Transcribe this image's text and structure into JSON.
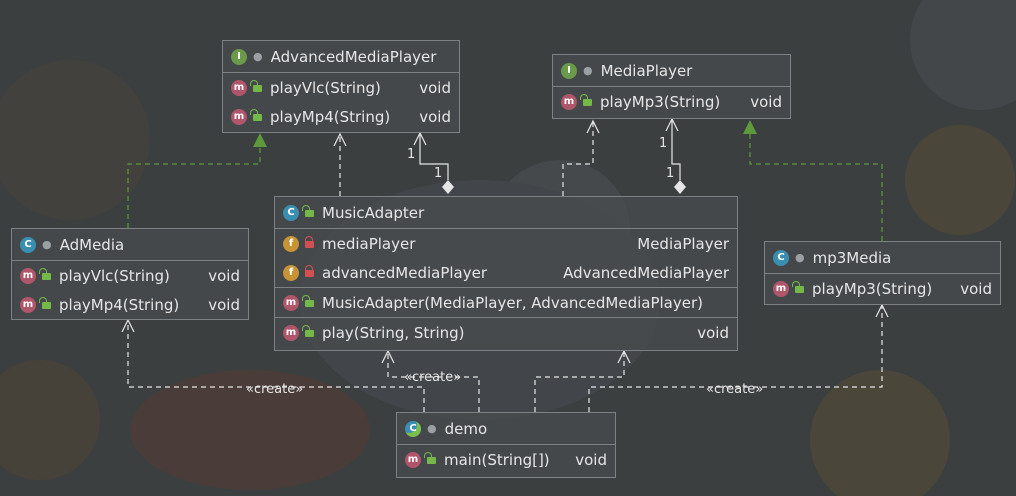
{
  "colors": {
    "background": "#3b3e3f",
    "box": "#484c4f",
    "border": "#7c8185",
    "implements_arrow": "#5d9a3c",
    "association_line": "#e6e6e6"
  },
  "classes": {
    "advanced_media_player": {
      "name": "AdvancedMediaPlayer",
      "kind_icon": "I",
      "methods": [
        {
          "name": "playVlc(String)",
          "type": "void"
        },
        {
          "name": "playMp4(String)",
          "type": "void"
        }
      ]
    },
    "media_player": {
      "name": "MediaPlayer",
      "kind_icon": "I",
      "methods": [
        {
          "name": "playMp3(String)",
          "type": "void"
        }
      ]
    },
    "ad_media": {
      "name": "AdMedia",
      "kind_icon": "C",
      "methods": [
        {
          "name": "playVlc(String)",
          "type": "void"
        },
        {
          "name": "playMp4(String)",
          "type": "void"
        }
      ]
    },
    "music_adapter": {
      "name": "MusicAdapter",
      "kind_icon": "C",
      "fields": [
        {
          "name": "mediaPlayer",
          "type": "MediaPlayer"
        },
        {
          "name": "advancedMediaPlayer",
          "type": "AdvancedMediaPlayer"
        }
      ],
      "constructor": {
        "name": "MusicAdapter(MediaPlayer, AdvancedMediaPlayer)"
      },
      "methods": [
        {
          "name": "play(String, String)",
          "type": "void"
        }
      ]
    },
    "mp3_media": {
      "name": "mp3Media",
      "kind_icon": "C",
      "methods": [
        {
          "name": "playMp3(String)",
          "type": "void"
        }
      ]
    },
    "demo": {
      "name": "demo",
      "kind_icon": "C",
      "methods": [
        {
          "name": "main(String[])",
          "type": "void"
        }
      ]
    }
  },
  "icons": {
    "field": "f",
    "method": "m"
  },
  "relations": {
    "create_label": "«create»",
    "multiplicity_one": "1"
  }
}
